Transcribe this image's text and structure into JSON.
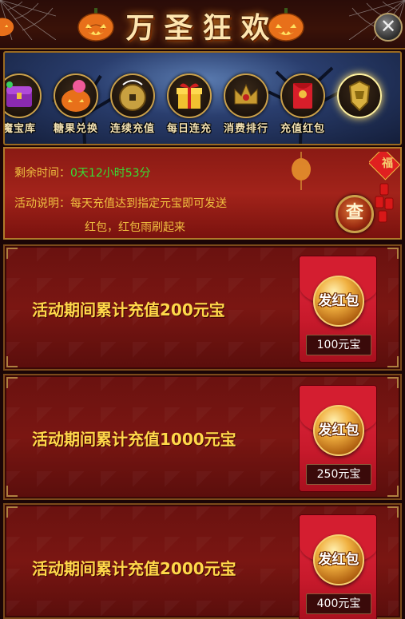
{
  "window": {
    "title": "万圣狂欢",
    "close_label": "✕"
  },
  "categories": [
    {
      "label": "魔宝库",
      "icon": "purple-chest-icon",
      "active": false
    },
    {
      "label": "糖果兑换",
      "icon": "pumpkin-icon",
      "active": false
    },
    {
      "label": "连续充值",
      "icon": "coin-icon",
      "active": false
    },
    {
      "label": "每日连充",
      "icon": "gift-box-icon",
      "active": false
    },
    {
      "label": "消费排行",
      "icon": "crown-icon",
      "active": false
    },
    {
      "label": "充值红包",
      "icon": "red-envelope-icon",
      "active": false
    },
    {
      "label": "",
      "icon": "golden-armor-icon",
      "active": true
    }
  ],
  "info": {
    "remaining_label": "剩余时间：",
    "remaining_value": "0天12小时53分",
    "desc_label": "活动说明：",
    "desc_line1": "每天充值达到指定元宝即可发送",
    "desc_line2": "红包，红包雨刷起来",
    "check_label": "查",
    "fu_char": "福"
  },
  "rewards": [
    {
      "text": "活动期间累计充值200元宝",
      "button": "发红包",
      "amount": "100元宝"
    },
    {
      "text": "活动期间累计充值1000元宝",
      "button": "发红包",
      "amount": "250元宝"
    },
    {
      "text": "活动期间累计充值2000元宝",
      "button": "发红包",
      "amount": "400元宝"
    }
  ],
  "colors": {
    "accent_gold": "#f0c040",
    "time_green": "#35e035",
    "panel_red": "#a2231a"
  }
}
